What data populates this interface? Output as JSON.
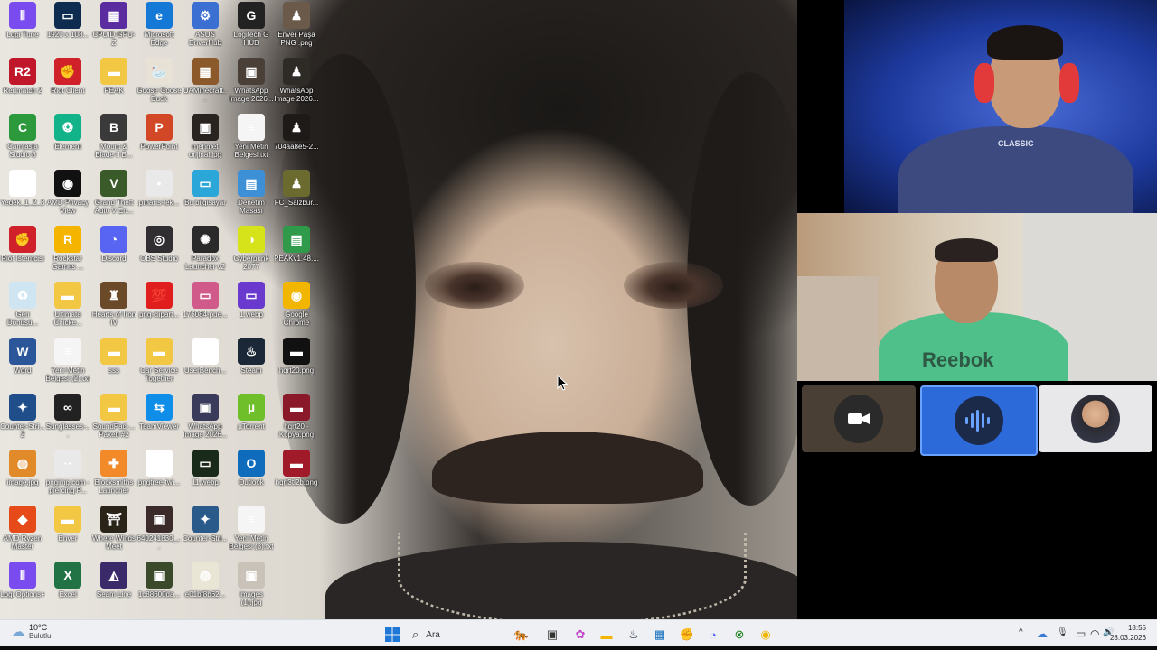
{
  "desktop": {
    "icons": [
      {
        "label": "Logi Tune",
        "color": "#7a4cf0",
        "glyph": "⦀"
      },
      {
        "label": "1920 x 108...",
        "color": "#0d2c4f",
        "glyph": "▭"
      },
      {
        "label": "CPUID GPU-Z",
        "color": "#5b2ca0",
        "glyph": "▦"
      },
      {
        "label": "Microsoft Edge",
        "color": "#1479d6",
        "glyph": "e"
      },
      {
        "label": "ASUS DriverHub",
        "color": "#3b6fd1",
        "glyph": "⚙"
      },
      {
        "label": "Logitech G HUB",
        "color": "#222222",
        "glyph": "G"
      },
      {
        "label": "Enver Paşa PNG .png",
        "color": "#6b5a4a",
        "glyph": "♟"
      },
      {
        "label": "Redmatch 2",
        "color": "#c0182a",
        "glyph": "R2"
      },
      {
        "label": "Riot Client",
        "color": "#d0202a",
        "glyph": "✊"
      },
      {
        "label": "PEAK",
        "color": "#f2c744",
        "glyph": "▬"
      },
      {
        "label": "Goose Goose Duck",
        "color": "#e8e2d6",
        "glyph": "🦢"
      },
      {
        "label": "UAMinecraft...",
        "color": "#8c5a2a",
        "glyph": "▦"
      },
      {
        "label": "WhatsApp Image 2026...",
        "color": "#4a4038",
        "glyph": "▣"
      },
      {
        "label": "WhatsApp Image 2026...",
        "color": "#2e2a26",
        "glyph": "♟"
      },
      {
        "label": "Camtasia Studio 8",
        "color": "#2c9a3c",
        "glyph": "C"
      },
      {
        "label": "Element",
        "color": "#13b38a",
        "glyph": "❂"
      },
      {
        "label": "Mount & Blade II B...",
        "color": "#3a3a3a",
        "glyph": "B"
      },
      {
        "label": "PowerPoint",
        "color": "#d24726",
        "glyph": "P"
      },
      {
        "label": "mehmet orijinal.jpg",
        "color": "#2a2420",
        "glyph": "▣"
      },
      {
        "label": "Yeni Metin Belgesi.txt",
        "color": "#f5f5f5",
        "glyph": "≡"
      },
      {
        "label": "704aa8e5-2...",
        "color": "#1e1a18",
        "glyph": "♟"
      },
      {
        "label": "Yedek_1_2_3",
        "color": "#ffffff",
        "glyph": "≡"
      },
      {
        "label": "AMD Privacy View",
        "color": "#111111",
        "glyph": "◉"
      },
      {
        "label": "Grand Theft Auto V En...",
        "color": "#3a5a2a",
        "glyph": "V"
      },
      {
        "label": "pınarıs-tek...",
        "color": "#e9e9e9",
        "glyph": "•"
      },
      {
        "label": "Bu bilgisayar",
        "color": "#2aa6d8",
        "glyph": "▭"
      },
      {
        "label": "Denetim Masası",
        "color": "#3d8fd6",
        "glyph": "▤"
      },
      {
        "label": "FC_Salzbur...",
        "color": "#6b6b30",
        "glyph": "♟"
      },
      {
        "label": "Riot İstemcisi",
        "color": "#d0202a",
        "glyph": "✊"
      },
      {
        "label": "Rockstar Games ...",
        "color": "#f4b400",
        "glyph": "R"
      },
      {
        "label": "Discord",
        "color": "#5865f2",
        "glyph": "◔"
      },
      {
        "label": "OBS Studio",
        "color": "#302e31",
        "glyph": "◎"
      },
      {
        "label": "Paradox Launcher v2",
        "color": "#2a2a2a",
        "glyph": "✺"
      },
      {
        "label": "Cyberpunk 2077",
        "color": "#d7e31a",
        "glyph": "◑"
      },
      {
        "label": "PEAKv1.48....",
        "color": "#2e9a4a",
        "glyph": "▤"
      },
      {
        "label": "Geri Dönüşü...",
        "color": "#cfe6f2",
        "glyph": "♻"
      },
      {
        "label": "Ultimate Chicke...",
        "color": "#f2c744",
        "glyph": "▬"
      },
      {
        "label": "Hearts of Iron IV",
        "color": "#6b4a2a",
        "glyph": "♜"
      },
      {
        "label": "png-clipart...",
        "color": "#e01e1e",
        "glyph": "💯"
      },
      {
        "label": "176084-pue...",
        "color": "#d05a8a",
        "glyph": "▭"
      },
      {
        "label": "1.webp",
        "color": "#6a3acf",
        "glyph": "▭"
      },
      {
        "label": "Google Chrome Canary",
        "color": "#f2b600",
        "glyph": "◉"
      },
      {
        "label": "Word",
        "color": "#2b579a",
        "glyph": "W"
      },
      {
        "label": "Yeni Metin Belgesi (2).txt",
        "color": "#f5f5f5",
        "glyph": "≡"
      },
      {
        "label": "sss",
        "color": "#f2c744",
        "glyph": "▬"
      },
      {
        "label": "Car Service Together",
        "color": "#f2c744",
        "glyph": "▬"
      },
      {
        "label": "UserBench...",
        "color": "#ffffff",
        "glyph": "◷"
      },
      {
        "label": "Steam",
        "color": "#1b2838",
        "glyph": "♨"
      },
      {
        "label": "hqrt20.png",
        "color": "#111111",
        "glyph": "▬"
      },
      {
        "label": "Counter-Stri... 2",
        "color": "#1f4e8a",
        "glyph": "✦"
      },
      {
        "label": "Sunglasses-...",
        "color": "#222222",
        "glyph": "∞"
      },
      {
        "label": "SoundPad-... Paketi #2",
        "color": "#f2c744",
        "glyph": "▬"
      },
      {
        "label": "TeamViewer",
        "color": "#0e8ee9",
        "glyph": "⇆"
      },
      {
        "label": "WhatsApp Image 2026...",
        "color": "#3a3a5a",
        "glyph": "▣"
      },
      {
        "label": "µTorrent",
        "color": "#6fbf2a",
        "glyph": "µ"
      },
      {
        "label": "hqrt20 - Kopya.png",
        "color": "#8a1a2a",
        "glyph": "▬"
      },
      {
        "label": "image.jpg",
        "color": "#e08a2a",
        "glyph": "◍"
      },
      {
        "label": "pngimg.com - piercing P...",
        "color": "#e9e9e9",
        "glyph": "··"
      },
      {
        "label": "Blocksmiths Launcher",
        "color": "#f28a2a",
        "glyph": "✚"
      },
      {
        "label": "pngtree-twi...",
        "color": "#ffffff",
        "glyph": "▭"
      },
      {
        "label": "11.webp",
        "color": "#1a2a1a",
        "glyph": "▭"
      },
      {
        "label": "Outlook",
        "color": "#0f6cbd",
        "glyph": "O"
      },
      {
        "label": "hqrt3tl2b.png",
        "color": "#a01a2a",
        "glyph": "▬"
      },
      {
        "label": "AMD Ryzen Master",
        "color": "#e64a19",
        "glyph": "◆"
      },
      {
        "label": "Enver",
        "color": "#f2c744",
        "glyph": "▬"
      },
      {
        "label": "Where Winds Meet",
        "color": "#2a2418",
        "glyph": "⛩"
      },
      {
        "label": "640241830_...",
        "color": "#3a2a2a",
        "glyph": "▣"
      },
      {
        "label": "Counter-Stri...",
        "color": "#2a5a8a",
        "glyph": "✦"
      },
      {
        "label": "Yeni Metin Belgesi (3).txt",
        "color": "#f5f5f5",
        "glyph": "≡"
      },
      {
        "label": "Logi Options+",
        "color": "#7a4cf0",
        "glyph": "⦀"
      },
      {
        "label": "Excel",
        "color": "#217346",
        "glyph": "X"
      },
      {
        "label": "Seam Line",
        "color": "#3a2a6a",
        "glyph": "◭"
      },
      {
        "label": "1c88600da...",
        "color": "#3a4a2a",
        "glyph": "▣"
      },
      {
        "label": "e01bf8b62...",
        "color": "#e9e6d6",
        "glyph": "◍"
      },
      {
        "label": "images (1).jpg",
        "color": "#c8c2b8",
        "glyph": "▣"
      }
    ]
  },
  "call": {
    "tiles": [
      {
        "name": "camera-tile",
        "bg": "#4a3f35",
        "circle": "#2a2a2a",
        "glyph": "■"
      },
      {
        "name": "speaking-tile",
        "bg": "#2d6ad9",
        "circle": "#1c2a4a",
        "glyph": "⦀"
      },
      {
        "name": "avatar-tile",
        "bg": "#e8e8ea",
        "circle": "#9aa2b0",
        "glyph": "☺"
      }
    ],
    "top_shirt_text": "CLASSIC",
    "mid_shirt_text": "Reebok"
  },
  "taskbar": {
    "weather": {
      "temp": "10°C",
      "condition": "Bulutlu"
    },
    "search_placeholder": "Ara",
    "apps": [
      {
        "name": "start-button",
        "glyph": "⊞",
        "color": "#1e78d7"
      },
      {
        "name": "search-icon",
        "glyph": "⌕",
        "color": "#333333"
      },
      {
        "name": "widget-app",
        "glyph": "🐅",
        "color": "#b07a2a"
      },
      {
        "name": "task-view-button",
        "glyph": "▣",
        "color": "#333333"
      },
      {
        "name": "copilot-app",
        "glyph": "✿",
        "color": "#c248c9"
      },
      {
        "name": "file-explorer-app",
        "glyph": "▬",
        "color": "#f2b600"
      },
      {
        "name": "steam-app",
        "glyph": "♨",
        "color": "#1b2838"
      },
      {
        "name": "microsoft-store-app",
        "glyph": "▦",
        "color": "#0f6cbd"
      },
      {
        "name": "riot-app",
        "glyph": "✊",
        "color": "#d0202a"
      },
      {
        "name": "discord-app",
        "glyph": "◔",
        "color": "#5865f2"
      },
      {
        "name": "xbox-app",
        "glyph": "⊗",
        "color": "#107c10"
      },
      {
        "name": "chrome-canary-app",
        "glyph": "◉",
        "color": "#f2b600"
      }
    ],
    "tray": {
      "chevron": "^",
      "network": "☁",
      "mic": "🎙",
      "display": "▭",
      "wifi": "◠",
      "volume": "🔊"
    },
    "clock": {
      "time": "18:55",
      "date": "28.03.2026"
    }
  }
}
